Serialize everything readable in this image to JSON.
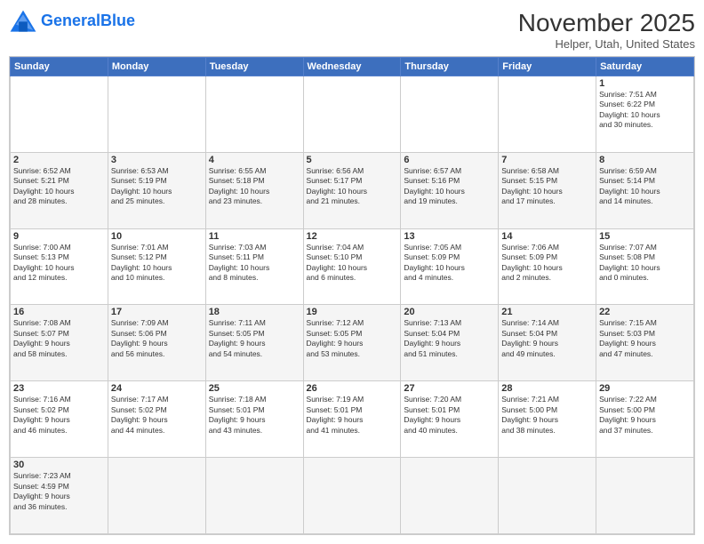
{
  "logo": {
    "text_general": "General",
    "text_blue": "Blue"
  },
  "header": {
    "month_title": "November 2025",
    "location": "Helper, Utah, United States"
  },
  "weekdays": [
    "Sunday",
    "Monday",
    "Tuesday",
    "Wednesday",
    "Thursday",
    "Friday",
    "Saturday"
  ],
  "weeks": [
    [
      {
        "day": "",
        "info": ""
      },
      {
        "day": "",
        "info": ""
      },
      {
        "day": "",
        "info": ""
      },
      {
        "day": "",
        "info": ""
      },
      {
        "day": "",
        "info": ""
      },
      {
        "day": "",
        "info": ""
      },
      {
        "day": "1",
        "info": "Sunrise: 7:51 AM\nSunset: 6:22 PM\nDaylight: 10 hours\nand 30 minutes."
      }
    ],
    [
      {
        "day": "2",
        "info": "Sunrise: 6:52 AM\nSunset: 5:21 PM\nDaylight: 10 hours\nand 28 minutes."
      },
      {
        "day": "3",
        "info": "Sunrise: 6:53 AM\nSunset: 5:19 PM\nDaylight: 10 hours\nand 25 minutes."
      },
      {
        "day": "4",
        "info": "Sunrise: 6:55 AM\nSunset: 5:18 PM\nDaylight: 10 hours\nand 23 minutes."
      },
      {
        "day": "5",
        "info": "Sunrise: 6:56 AM\nSunset: 5:17 PM\nDaylight: 10 hours\nand 21 minutes."
      },
      {
        "day": "6",
        "info": "Sunrise: 6:57 AM\nSunset: 5:16 PM\nDaylight: 10 hours\nand 19 minutes."
      },
      {
        "day": "7",
        "info": "Sunrise: 6:58 AM\nSunset: 5:15 PM\nDaylight: 10 hours\nand 17 minutes."
      },
      {
        "day": "8",
        "info": "Sunrise: 6:59 AM\nSunset: 5:14 PM\nDaylight: 10 hours\nand 14 minutes."
      }
    ],
    [
      {
        "day": "9",
        "info": "Sunrise: 7:00 AM\nSunset: 5:13 PM\nDaylight: 10 hours\nand 12 minutes."
      },
      {
        "day": "10",
        "info": "Sunrise: 7:01 AM\nSunset: 5:12 PM\nDaylight: 10 hours\nand 10 minutes."
      },
      {
        "day": "11",
        "info": "Sunrise: 7:03 AM\nSunset: 5:11 PM\nDaylight: 10 hours\nand 8 minutes."
      },
      {
        "day": "12",
        "info": "Sunrise: 7:04 AM\nSunset: 5:10 PM\nDaylight: 10 hours\nand 6 minutes."
      },
      {
        "day": "13",
        "info": "Sunrise: 7:05 AM\nSunset: 5:09 PM\nDaylight: 10 hours\nand 4 minutes."
      },
      {
        "day": "14",
        "info": "Sunrise: 7:06 AM\nSunset: 5:09 PM\nDaylight: 10 hours\nand 2 minutes."
      },
      {
        "day": "15",
        "info": "Sunrise: 7:07 AM\nSunset: 5:08 PM\nDaylight: 10 hours\nand 0 minutes."
      }
    ],
    [
      {
        "day": "16",
        "info": "Sunrise: 7:08 AM\nSunset: 5:07 PM\nDaylight: 9 hours\nand 58 minutes."
      },
      {
        "day": "17",
        "info": "Sunrise: 7:09 AM\nSunset: 5:06 PM\nDaylight: 9 hours\nand 56 minutes."
      },
      {
        "day": "18",
        "info": "Sunrise: 7:11 AM\nSunset: 5:05 PM\nDaylight: 9 hours\nand 54 minutes."
      },
      {
        "day": "19",
        "info": "Sunrise: 7:12 AM\nSunset: 5:05 PM\nDaylight: 9 hours\nand 53 minutes."
      },
      {
        "day": "20",
        "info": "Sunrise: 7:13 AM\nSunset: 5:04 PM\nDaylight: 9 hours\nand 51 minutes."
      },
      {
        "day": "21",
        "info": "Sunrise: 7:14 AM\nSunset: 5:04 PM\nDaylight: 9 hours\nand 49 minutes."
      },
      {
        "day": "22",
        "info": "Sunrise: 7:15 AM\nSunset: 5:03 PM\nDaylight: 9 hours\nand 47 minutes."
      }
    ],
    [
      {
        "day": "23",
        "info": "Sunrise: 7:16 AM\nSunset: 5:02 PM\nDaylight: 9 hours\nand 46 minutes."
      },
      {
        "day": "24",
        "info": "Sunrise: 7:17 AM\nSunset: 5:02 PM\nDaylight: 9 hours\nand 44 minutes."
      },
      {
        "day": "25",
        "info": "Sunrise: 7:18 AM\nSunset: 5:01 PM\nDaylight: 9 hours\nand 43 minutes."
      },
      {
        "day": "26",
        "info": "Sunrise: 7:19 AM\nSunset: 5:01 PM\nDaylight: 9 hours\nand 41 minutes."
      },
      {
        "day": "27",
        "info": "Sunrise: 7:20 AM\nSunset: 5:01 PM\nDaylight: 9 hours\nand 40 minutes."
      },
      {
        "day": "28",
        "info": "Sunrise: 7:21 AM\nSunset: 5:00 PM\nDaylight: 9 hours\nand 38 minutes."
      },
      {
        "day": "29",
        "info": "Sunrise: 7:22 AM\nSunset: 5:00 PM\nDaylight: 9 hours\nand 37 minutes."
      }
    ],
    [
      {
        "day": "30",
        "info": "Sunrise: 7:23 AM\nSunset: 4:59 PM\nDaylight: 9 hours\nand 36 minutes."
      },
      {
        "day": "",
        "info": ""
      },
      {
        "day": "",
        "info": ""
      },
      {
        "day": "",
        "info": ""
      },
      {
        "day": "",
        "info": ""
      },
      {
        "day": "",
        "info": ""
      },
      {
        "day": "",
        "info": ""
      }
    ]
  ]
}
